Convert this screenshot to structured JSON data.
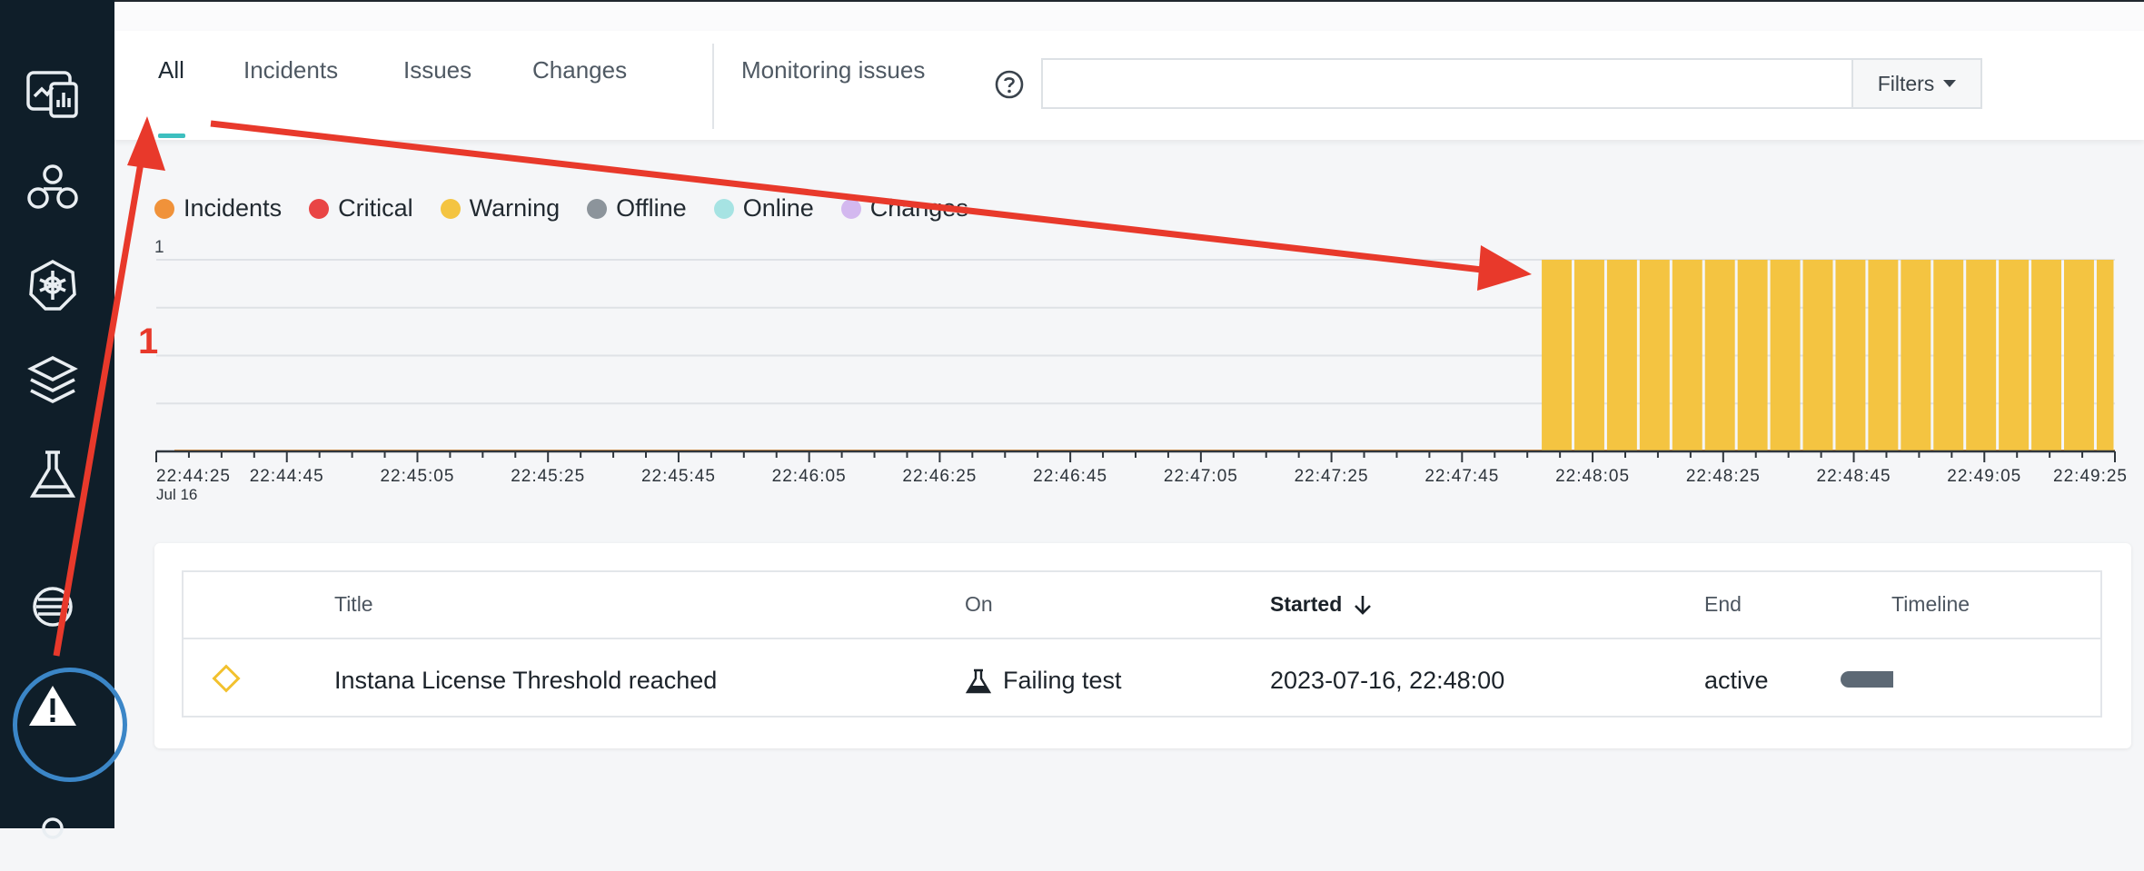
{
  "tabs": [
    {
      "label": "All",
      "active": true
    },
    {
      "label": "Incidents",
      "active": false
    },
    {
      "label": "Issues",
      "active": false
    },
    {
      "label": "Changes",
      "active": false
    },
    {
      "label": "Monitoring issues",
      "active": false
    }
  ],
  "search": {
    "value": "",
    "placeholder": ""
  },
  "filters": {
    "label": "Filters"
  },
  "legend": [
    {
      "label": "Incidents",
      "color": "#f0923a"
    },
    {
      "label": "Critical",
      "color": "#e94545"
    },
    {
      "label": "Warning",
      "color": "#f4c441"
    },
    {
      "label": "Offline",
      "color": "#8c949b"
    },
    {
      "label": "Online",
      "color": "#a6e3e3"
    },
    {
      "label": "Changes",
      "color": "#d3b8ef"
    }
  ],
  "chart_data": {
    "type": "bar",
    "title": "",
    "xlabel": "",
    "ylabel": "",
    "ylim": [
      0,
      1
    ],
    "y_tick_label": "1",
    "x_tick_labels": [
      "22:44:25",
      "22:44:45",
      "22:45:05",
      "22:45:25",
      "22:45:45",
      "22:46:05",
      "22:46:25",
      "22:46:45",
      "22:47:05",
      "22:47:25",
      "22:47:45",
      "22:48:05",
      "22:48:25",
      "22:48:45",
      "22:49:05",
      "22:49:25"
    ],
    "x_date_label": "Jul 16",
    "series": [
      {
        "name": "Warning",
        "color": "#f4c441",
        "x_start": "22:47:57",
        "x_end": "22:49:25",
        "bucket_seconds": 5,
        "value": 1
      }
    ],
    "grid": true
  },
  "table": {
    "headers": {
      "title": "Title",
      "on": "On",
      "started": "Started",
      "end": "End",
      "timeline": "Timeline"
    },
    "rows": [
      {
        "title": "Instana License Threshold reached",
        "on": "Failing test",
        "started": "2023-07-16, 22:48:00",
        "end": "active",
        "severity_icon": "warning-diamond-icon"
      }
    ]
  },
  "annotation": {
    "label": "1",
    "color": "#e8392b"
  },
  "sidebar": {
    "items": [
      {
        "icon": "dashboard-icon"
      },
      {
        "icon": "services-icon"
      },
      {
        "icon": "kubernetes-icon"
      },
      {
        "icon": "stack-icon"
      },
      {
        "icon": "lab-flask-icon"
      },
      {
        "icon": "catalog-icon"
      },
      {
        "icon": "events-warning-icon",
        "active": true
      }
    ]
  }
}
